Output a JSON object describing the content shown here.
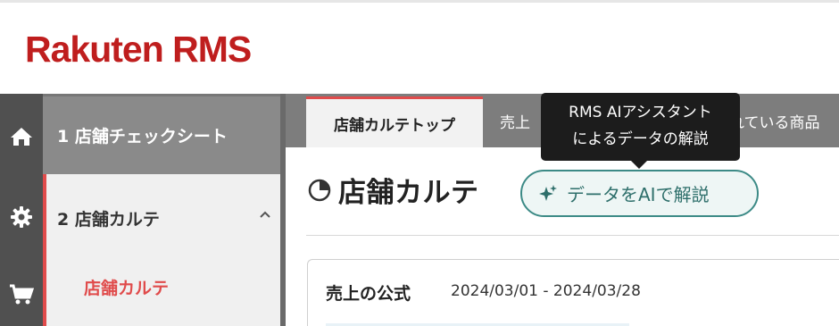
{
  "header": {
    "logo_text": "Rakuten RMS"
  },
  "icon_bar": {
    "items": [
      {
        "icon": "home-icon"
      },
      {
        "icon": "gear-icon"
      },
      {
        "icon": "cart-icon"
      }
    ]
  },
  "sidebar": {
    "items": [
      {
        "label": "1 店舗チェックシート"
      },
      {
        "label": "2 店舗カルテ",
        "expanded": true,
        "children": [
          {
            "label": "店舗カルテ",
            "active": true
          }
        ]
      }
    ]
  },
  "tabs": [
    {
      "label": "店舗カルテトップ",
      "active": true
    },
    {
      "label": "売上"
    },
    {
      "label": "れている商品"
    }
  ],
  "tooltip": {
    "line1": "RMS AIアシスタント",
    "line2": "によるデータの解説"
  },
  "main": {
    "title": "店舗カルテ",
    "ai_button_label": "データをAIで解説"
  },
  "card": {
    "title": "売上の公式",
    "date_range": "2024/03/01 - 2024/03/28"
  },
  "colors": {
    "brand_red": "#bf1e1e",
    "accent_red": "#e04b4b",
    "teal": "#3c8a86"
  }
}
